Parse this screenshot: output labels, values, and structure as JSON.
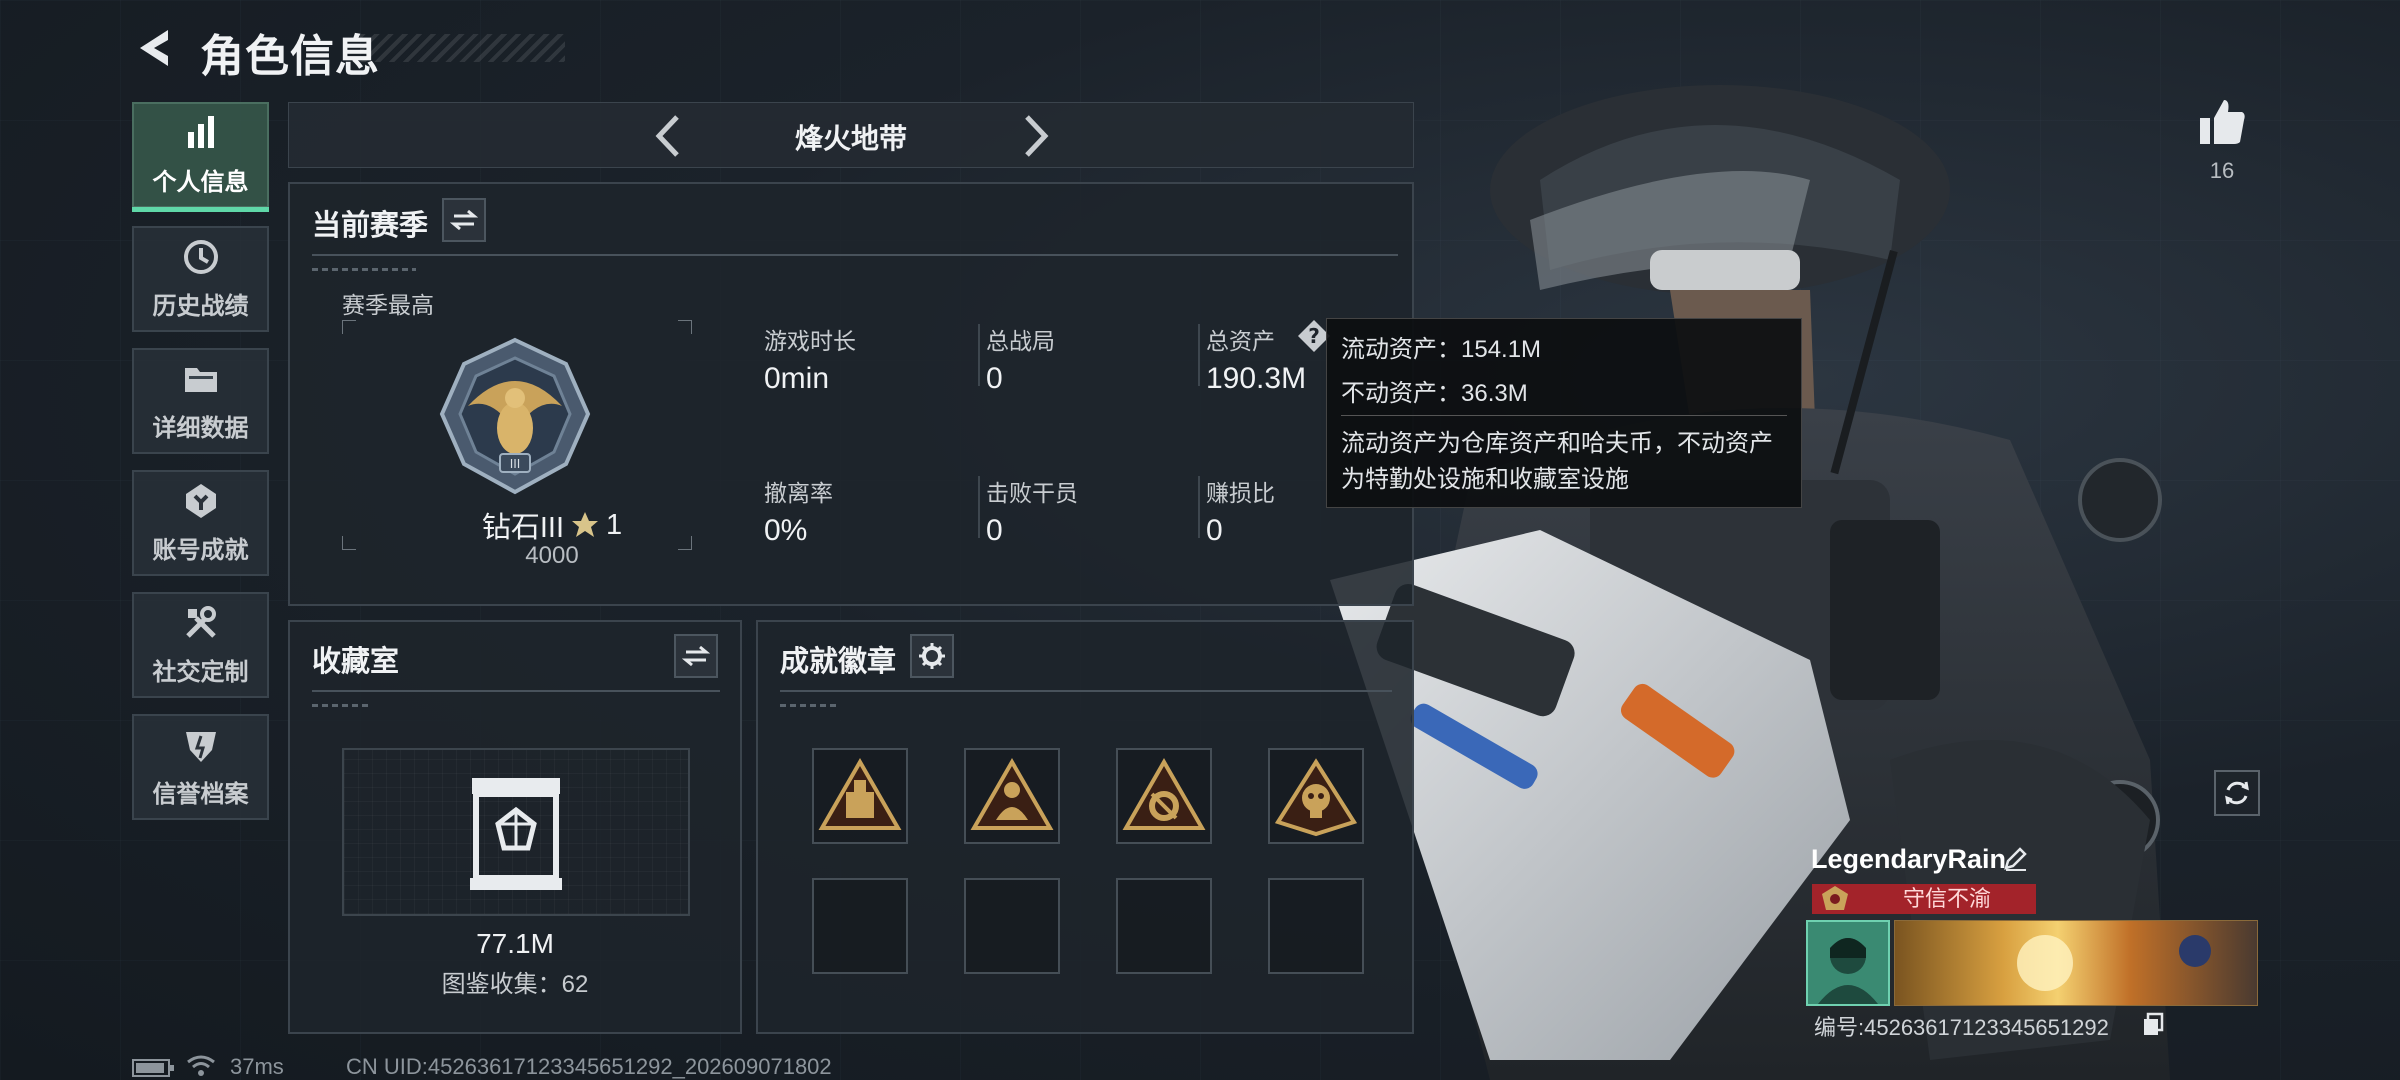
{
  "header": {
    "title": "角色信息"
  },
  "sidebar": {
    "items": [
      {
        "label": "个人信息",
        "icon": "bar-chart-icon",
        "active": true
      },
      {
        "label": "历史战绩",
        "icon": "history-clock-icon",
        "active": false
      },
      {
        "label": "详细数据",
        "icon": "folder-icon",
        "active": false
      },
      {
        "label": "账号成就",
        "icon": "achievement-badge-icon",
        "active": false
      },
      {
        "label": "社交定制",
        "icon": "tools-icon",
        "active": false
      },
      {
        "label": "信誉档案",
        "icon": "credit-shield-icon",
        "active": false
      }
    ]
  },
  "mode": {
    "title": "烽火地带"
  },
  "season": {
    "title": "当前赛季",
    "best_label": "赛季最高",
    "rank_name": "钻石III",
    "rank_stars": "1",
    "rank_points": "4000",
    "stats": [
      {
        "label": "游戏时长",
        "value": "0min"
      },
      {
        "label": "总战局",
        "value": "0"
      },
      {
        "label": "总资产",
        "value": "190.3M"
      },
      {
        "label": "撤离率",
        "value": "0%"
      },
      {
        "label": "击败干员",
        "value": "0"
      },
      {
        "label": "赚损比",
        "value": "0"
      }
    ]
  },
  "tooltip": {
    "liquid": "流动资产：154.1M",
    "fixed": "不动资产：36.3M",
    "desc_line1": "流动资产为仓库资产和哈夫币，不动资产",
    "desc_line2": "为特勤处设施和收藏室设施"
  },
  "collection": {
    "title": "收藏室",
    "value": "77.1M",
    "count_text": "图鉴收集：62"
  },
  "badges": {
    "title": "成就徽章",
    "slots": [
      "bunker-badge-icon",
      "figure-badge-icon",
      "gear-badge-icon",
      "skull-badge-icon",
      "",
      "",
      "",
      ""
    ]
  },
  "likes": {
    "count": "16"
  },
  "player": {
    "name": "LegendaryRain",
    "title": "守信不渝",
    "id_text": "编号:452636171233456512​92"
  },
  "status_bar": {
    "ping": "37ms",
    "uid": "CN UID:452636171233456512​92_202609071802"
  },
  "colors": {
    "accent_green": "#5fd8a8",
    "title_red": "#a3232a",
    "gold": "#c9a25a"
  }
}
